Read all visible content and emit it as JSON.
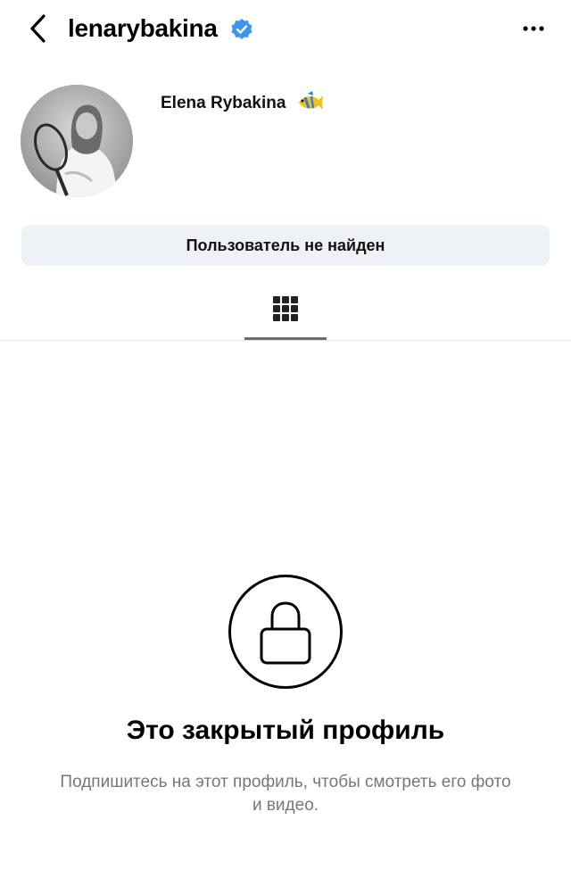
{
  "header": {
    "username": "lenarybakina",
    "back_icon": "chevron-left-icon",
    "verified_icon": "verified-badge-icon",
    "more_icon": "more-horizontal-icon"
  },
  "profile": {
    "display_name": "Elena Rybakina",
    "name_emoji_icon": "tropical-fish-icon",
    "status_button_label": "Пользователь не найден"
  },
  "tabs": {
    "grid_icon": "grid-icon"
  },
  "private": {
    "icon": "lock-icon",
    "title": "Это закрытый профиль",
    "subtitle": "Подпишитесь на этот профиль, чтобы смотреть его фото и видео."
  },
  "colors": {
    "verified_blue": "#3897f0",
    "button_bg": "#eef1f5",
    "secondary_text": "#777777"
  }
}
